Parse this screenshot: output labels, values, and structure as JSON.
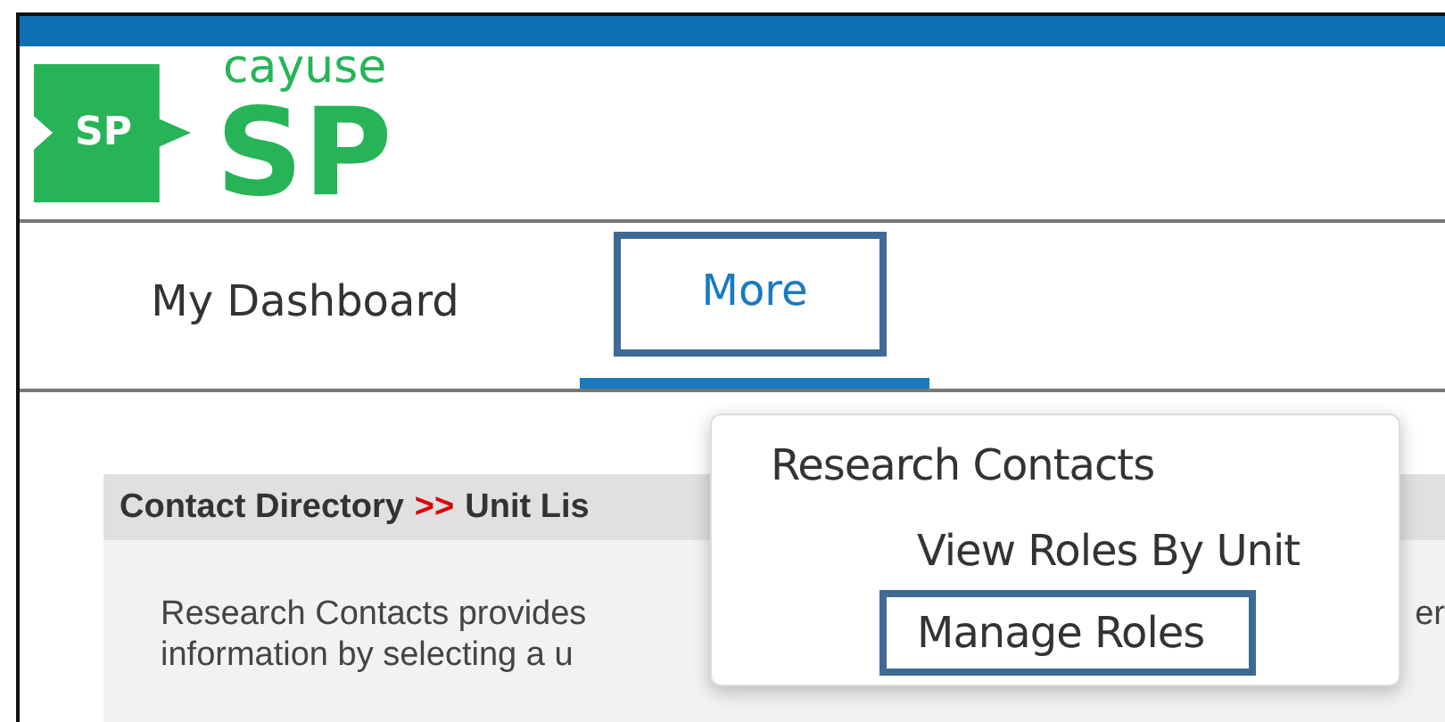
{
  "logo": {
    "badge": "SP",
    "brand": "cayuse",
    "product": "SP"
  },
  "tabs": [
    {
      "label": "My Dashboard",
      "selected": false,
      "highlighted": false
    },
    {
      "label": "More",
      "selected": true,
      "highlighted": true
    }
  ],
  "panel": {
    "breadcrumb": [
      {
        "kind": "link",
        "text": "Contact Directory"
      },
      {
        "kind": "separator",
        "text": ">>"
      },
      {
        "kind": "link",
        "text": "Unit Lis"
      }
    ],
    "lines": [
      {
        "left": "Research Contacts provides",
        "right": "er"
      },
      {
        "left": "information by selecting a u"
      }
    ]
  },
  "menu": {
    "heading": "Research Contacts",
    "items": [
      {
        "label": "View Roles By Unit",
        "highlighted": false
      },
      {
        "label": "Manage Roles",
        "highlighted": true
      }
    ]
  }
}
